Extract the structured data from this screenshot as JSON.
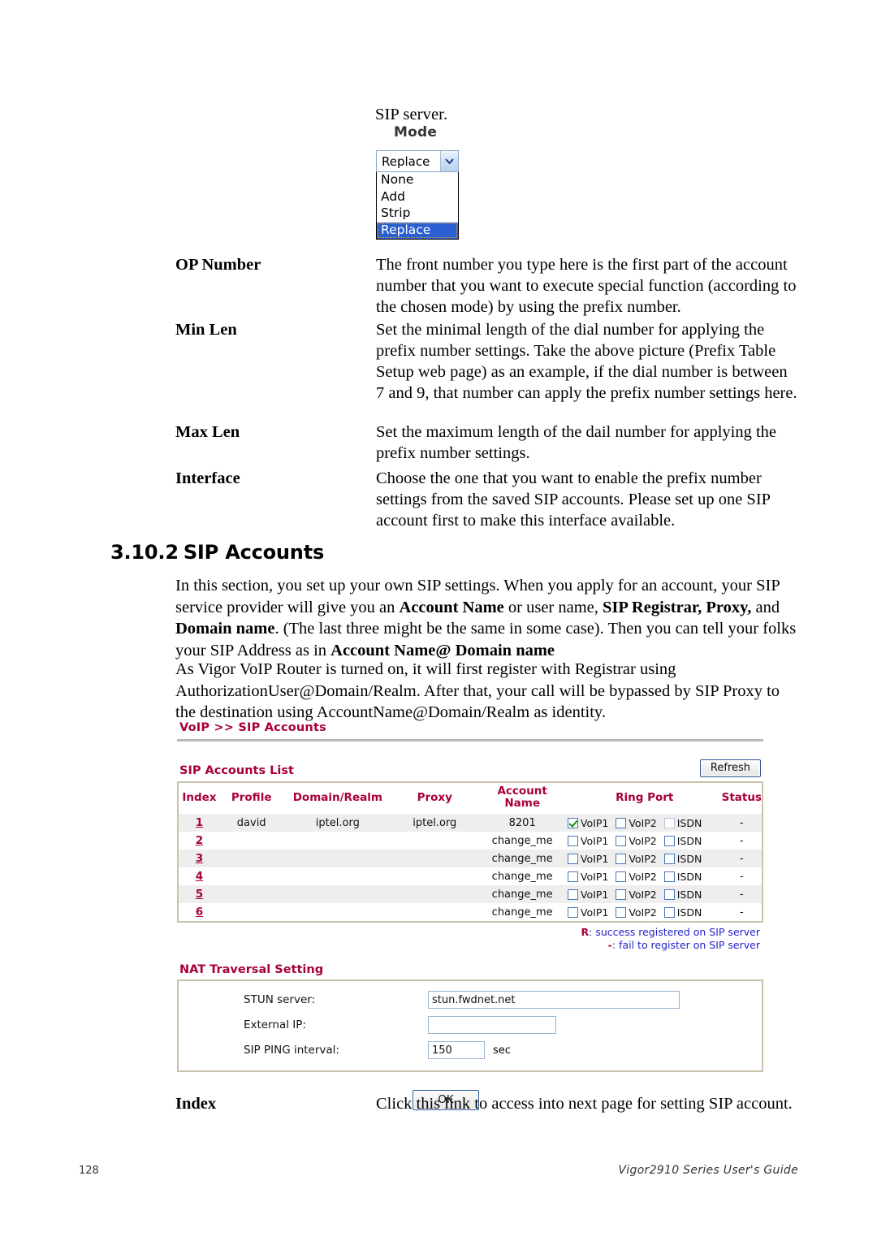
{
  "top_illustration": {
    "caption": "SIP server.",
    "mode_label": "Mode",
    "select": {
      "selected": "Replace",
      "options": [
        "None",
        "Add",
        "Strip",
        "Replace"
      ],
      "arrow_icon": "chevron-down-icon"
    }
  },
  "definitions_top": [
    {
      "term": "OP Number",
      "desc": "The front number you type here is the first part of the account number that you want to execute special function (according to the chosen mode) by using the prefix number."
    },
    {
      "term": "Min Len",
      "desc": "Set the minimal length of the dial number for applying the prefix number settings. Take the above picture (Prefix Table Setup web page) as an example, if the dial number is between 7 and 9, that number can apply the prefix number settings here."
    },
    {
      "term": "Max Len",
      "desc": "Set the maximum length of the dail number for applying the prefix number settings."
    },
    {
      "term": "Interface",
      "desc": "Choose the one that you want to enable the prefix number settings from the saved SIP accounts. Please set up one SIP account first to make this interface available."
    }
  ],
  "section": {
    "number": "3.10.2",
    "title": "SIP Accounts"
  },
  "paragraphs": {
    "p1_a": "In this section, you set up your own SIP settings. When you apply for an account, your SIP service provider will give you an ",
    "p1_b1": "Account Name",
    "p1_c": " or user name, ",
    "p1_b2": "SIP Registrar, Proxy,",
    "p1_d": " and ",
    "p1_b3": "Domain name",
    "p1_e": ". (The last three might be the same in some case). Then you can tell your folks your SIP Address as in ",
    "p1_b4": "Account Name@ Domain name",
    "p2": "As Vigor VoIP Router is turned on, it will first register with Registrar using AuthorizationUser@Domain/Realm. After that, your call will be bypassed by SIP Proxy to the destination using AccountName@Domain/Realm as identity."
  },
  "webui": {
    "breadcrumb": "VoIP >> SIP Accounts",
    "list_title": "SIP Accounts List",
    "refresh_label": "Refresh",
    "table": {
      "headers": [
        "Index",
        "Profile",
        "Domain/Realm",
        "Proxy",
        "Account Name",
        "Ring Port",
        "Status"
      ],
      "ring_port_options": [
        "VoIP1",
        "VoIP2",
        "ISDN"
      ],
      "rows": [
        {
          "index": "1",
          "profile": "david",
          "domain": "iptel.org",
          "proxy": "iptel.org",
          "account": "8201",
          "ring": [
            true,
            false,
            false
          ],
          "status": "-"
        },
        {
          "index": "2",
          "profile": "",
          "domain": "",
          "proxy": "",
          "account": "change_me",
          "ring": [
            false,
            false,
            false
          ],
          "status": "-"
        },
        {
          "index": "3",
          "profile": "",
          "domain": "",
          "proxy": "",
          "account": "change_me",
          "ring": [
            false,
            false,
            false
          ],
          "status": "-"
        },
        {
          "index": "4",
          "profile": "",
          "domain": "",
          "proxy": "",
          "account": "change_me",
          "ring": [
            false,
            false,
            false
          ],
          "status": "-"
        },
        {
          "index": "5",
          "profile": "",
          "domain": "",
          "proxy": "",
          "account": "change_me",
          "ring": [
            false,
            false,
            false
          ],
          "status": "-"
        },
        {
          "index": "6",
          "profile": "",
          "domain": "",
          "proxy": "",
          "account": "change_me",
          "ring": [
            false,
            false,
            false
          ],
          "status": "-"
        }
      ]
    },
    "legend": {
      "r_mark": "R",
      "r_text": ": success registered on SIP server",
      "dash_mark": "-",
      "dash_text": ": fail to register on SIP server"
    },
    "nat": {
      "title": "NAT Traversal Setting",
      "stun_label": "STUN server:",
      "stun_value": "stun.fwdnet.net",
      "extip_label": "External IP:",
      "extip_value": "",
      "ping_label": "SIP PING interval:",
      "ping_value": "150",
      "ping_unit": "sec"
    },
    "ok_label": "OK",
    "accent_color": "#a8003c",
    "link_color": "#2222cc"
  },
  "bottom_definition": {
    "term": "Index",
    "desc": "Click this link to access into next page for setting SIP account."
  },
  "footer": {
    "page_number": "128",
    "guide": "Vigor2910 Series User's Guide"
  }
}
